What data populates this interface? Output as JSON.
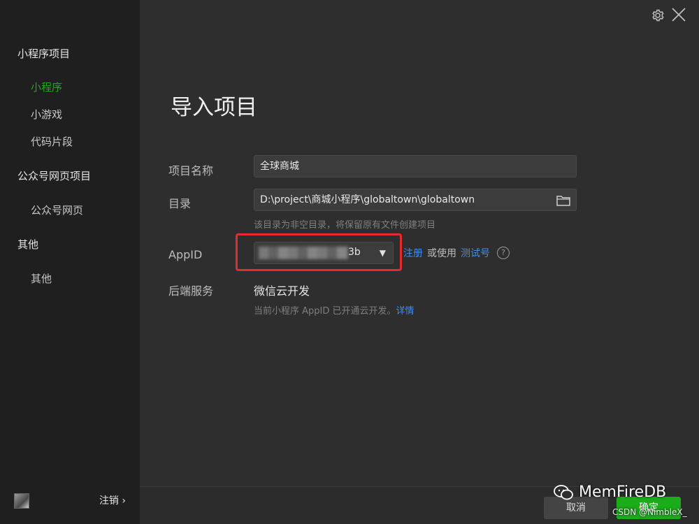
{
  "sidebar": {
    "groups": [
      {
        "label": "小程序项目",
        "items": [
          {
            "label": "小程序",
            "active": true
          },
          {
            "label": "小游戏",
            "active": false
          },
          {
            "label": "代码片段",
            "active": false
          }
        ]
      },
      {
        "label": "公众号网页项目",
        "items": [
          {
            "label": "公众号网页",
            "active": false
          }
        ]
      },
      {
        "label": "其他",
        "items": [
          {
            "label": "其他",
            "active": false
          }
        ]
      }
    ],
    "footer": {
      "logout_label": "注销 ›"
    }
  },
  "header": {
    "settings_icon": "gear-icon",
    "close_icon": "close-icon"
  },
  "main": {
    "title": "导入项目",
    "project_name": {
      "label": "项目名称",
      "value": "全球商城"
    },
    "directory": {
      "label": "目录",
      "value": "D:\\project\\商城小程序\\globaltown\\globaltown",
      "hint": "该目录为非空目录，将保留原有文件创建项目"
    },
    "appid": {
      "label": "AppID",
      "visible_suffix": "3b",
      "register_link": "注册",
      "or_use_text": "或使用",
      "test_account_link": "测试号"
    },
    "backend": {
      "label": "后端服务",
      "value": "微信云开发",
      "hint_prefix": "当前小程序 AppID 已开通云开发。",
      "details_link": "详情"
    }
  },
  "footer": {
    "cancel_label": "取消",
    "ok_label": "确定"
  },
  "watermark": {
    "brand": "MemFireDB",
    "sub": "CSDN @NimbleX_"
  },
  "colors": {
    "accent": "#1aad19",
    "link": "#3d8ef0",
    "highlight": "#e52b2b"
  }
}
